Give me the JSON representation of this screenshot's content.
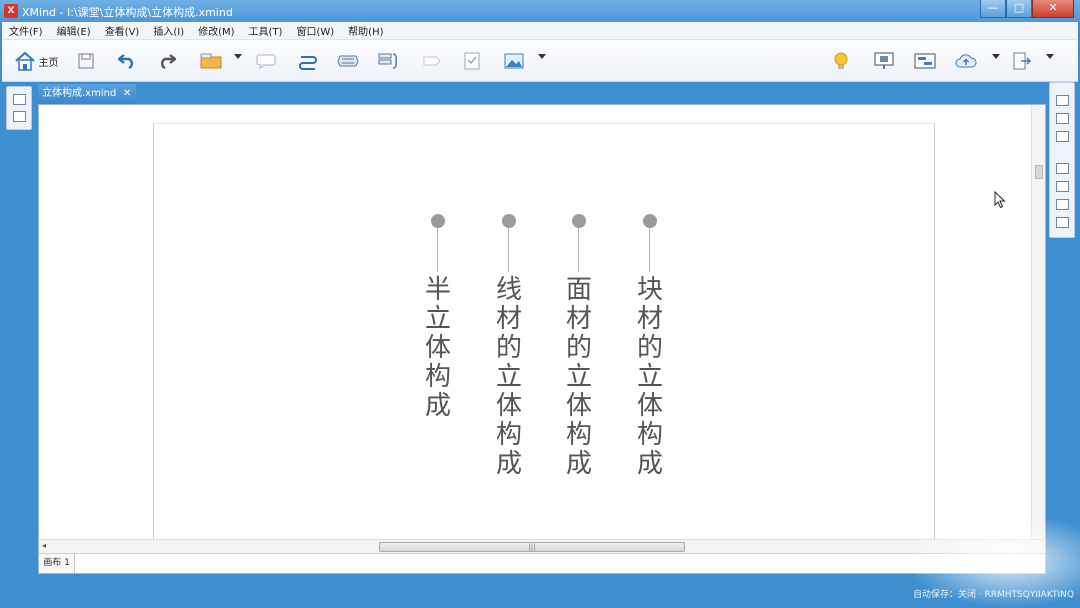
{
  "window": {
    "title": "XMind - I:\\课堂\\立体构成\\立体构成.xmind",
    "app_icon": "X",
    "minimize": "—",
    "maximize": "□",
    "close": "✕"
  },
  "menu": [
    "文件(F)",
    "编辑(E)",
    "查看(V)",
    "插入(I)",
    "修改(M)",
    "工具(T)",
    "窗口(W)",
    "帮助(H)"
  ],
  "toolbar": {
    "home_label": "主页",
    "icons": [
      "home-icon",
      "save-icon",
      "undo-icon",
      "redo-icon",
      "topic-icon",
      "callout-icon",
      "relationship-icon",
      "boundary-icon",
      "summary-icon",
      "marker-icon",
      "notes-icon",
      "image-icon",
      "idea-bulb-icon",
      "presentation-icon",
      "layout-icon",
      "cloud-upload-icon",
      "export-icon"
    ]
  },
  "editor": {
    "tab_label": "立体构成.xmind",
    "tab_close": "✕",
    "sheet_tab": "画布 1",
    "scroll_grip": "|||"
  },
  "mindmap": {
    "node_color": "#9b9b9b",
    "branches": [
      {
        "text": "半立体构成"
      },
      {
        "text": "线材的立体构成"
      },
      {
        "text": "面材的立体构成"
      },
      {
        "text": "块材的立体构成"
      }
    ]
  },
  "status": {
    "text": "自动保存：关闭  ·  RRMHTSQYIIAKTINQ"
  },
  "colors": {
    "frame": "#3f8fd0",
    "title_bar": "#4f97d8",
    "tab_active": "#3b86cc"
  }
}
